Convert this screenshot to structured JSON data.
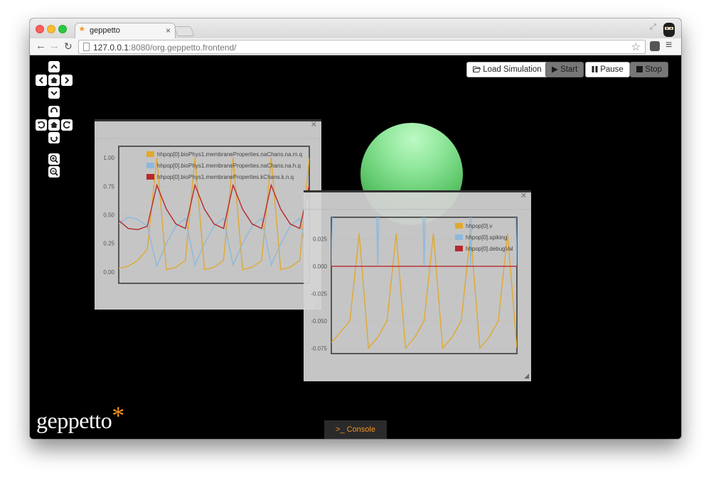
{
  "browser": {
    "tab_title": "geppetto",
    "tab_close": "×",
    "url_host": "127.0.0.1",
    "url_rest": ":8080/org.geppetto.frontend/"
  },
  "icons": {
    "back": "arrow-left-icon",
    "forward": "arrow-right-icon",
    "reload": "reload-icon",
    "star": "star-icon",
    "pocket": "pocket-icon",
    "menu": "hamburger-menu-icon",
    "fullscreen": "fullscreen-icon"
  },
  "toolbar": {
    "load_label": "Load Simulation",
    "start_label": "Start",
    "pause_label": "Pause",
    "stop_label": "Stop"
  },
  "camera_controls": {
    "pan_up": "^",
    "pan_left": "<",
    "pan_home": "⌂",
    "pan_right": ">",
    "pan_down": "v",
    "rot_up": "↻",
    "rot_left": "↺",
    "rot_home": "⌂",
    "rot_right": "↻",
    "rot_down": "↺",
    "zoom_in": "+",
    "zoom_out": "−"
  },
  "logo_text": "geppetto",
  "logo_star": "*",
  "console_label": "Console",
  "console_prompt": ">_",
  "colors": {
    "orange": "#f7931e",
    "yellow_series": "#e0a92e",
    "blue_series": "#8eb8dc",
    "red_series": "#b8282f"
  },
  "chart_data": [
    {
      "type": "line",
      "ylim": [
        -0.1,
        1.1
      ],
      "yticks": [
        "1.00",
        "0.75",
        "0.50",
        "0.25",
        "0.00"
      ],
      "grid": true,
      "legend_position": "top-right",
      "series": [
        {
          "name": "hhpop[0].bioPhys1.membraneProperties.naChans.na.m.q",
          "color": "#e0a92e",
          "values_sampled": [
            0.03,
            0.05,
            0.1,
            0.2,
            1.0,
            0.02,
            0.04,
            0.1,
            1.0,
            0.02,
            0.04,
            0.1,
            1.0,
            0.02,
            0.04,
            0.1,
            1.0,
            0.02,
            0.04,
            0.1,
            1.0
          ]
        },
        {
          "name": "hhpop[0].bioPhys1.membraneProperties.naChans.na.h.q",
          "color": "#8eb8dc",
          "values_sampled": [
            0.42,
            0.48,
            0.46,
            0.4,
            0.05,
            0.25,
            0.4,
            0.47,
            0.06,
            0.25,
            0.4,
            0.47,
            0.06,
            0.25,
            0.4,
            0.47,
            0.06,
            0.25,
            0.4,
            0.47,
            0.06
          ]
        },
        {
          "name": "hhpop[0].bioPhys1.membraneProperties.kChans.k.n.q",
          "color": "#b8282f",
          "values_sampled": [
            0.45,
            0.38,
            0.37,
            0.4,
            0.76,
            0.55,
            0.42,
            0.38,
            0.76,
            0.55,
            0.42,
            0.38,
            0.76,
            0.55,
            0.42,
            0.38,
            0.76,
            0.55,
            0.42,
            0.38,
            0.76
          ]
        }
      ]
    },
    {
      "type": "line",
      "ylim": [
        -0.08,
        0.045
      ],
      "yticks": [
        "0.025",
        "0.000",
        "-0.025",
        "-0.050",
        "-0.075"
      ],
      "grid": true,
      "legend_position": "top-right",
      "series": [
        {
          "name": "hhpop[0].v",
          "color": "#e0a92e",
          "values_sampled": [
            -0.07,
            -0.06,
            -0.05,
            0.03,
            -0.075,
            -0.065,
            -0.05,
            0.03,
            -0.075,
            -0.065,
            -0.05,
            0.03,
            -0.075,
            -0.065,
            -0.05,
            0.03,
            -0.075,
            -0.065,
            -0.05,
            0.03,
            -0.075
          ]
        },
        {
          "name": "hhpop[0].spiking",
          "color": "#8eb8dc",
          "values_sampled": [
            0.0,
            1.0,
            0.0,
            1.0,
            0.0,
            1.0,
            0.0,
            1.0,
            0.0
          ]
        },
        {
          "name": "hhpop[0].debugVal",
          "color": "#b8282f",
          "values_sampled": [
            0.0,
            0.0
          ]
        }
      ]
    }
  ]
}
